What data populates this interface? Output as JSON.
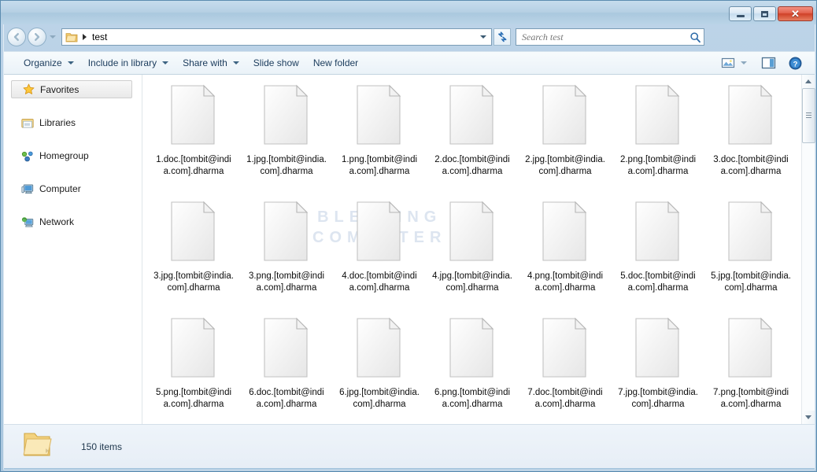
{
  "window": {
    "minimize_label": "Minimize",
    "maximize_label": "Maximize",
    "close_label": "✕"
  },
  "nav": {
    "back_label": "Back",
    "forward_label": "Forward",
    "recent_pages_label": "Recent pages",
    "breadcrumb": "test",
    "refresh_label": "Refresh"
  },
  "search": {
    "placeholder": "Search test",
    "value": ""
  },
  "toolbar": {
    "organize": "Organize",
    "include_in_library": "Include in library",
    "share_with": "Share with",
    "slide_show": "Slide show",
    "new_folder": "New folder",
    "view_label": "Change your view",
    "preview_pane_label": "Show the preview pane",
    "help_label": "Get help"
  },
  "sidebar": {
    "items": [
      {
        "label": "Favorites",
        "icon": "star-icon",
        "selected": true
      },
      {
        "label": "Libraries",
        "icon": "libraries-icon",
        "selected": false
      },
      {
        "label": "Homegroup",
        "icon": "homegroup-icon",
        "selected": false
      },
      {
        "label": "Computer",
        "icon": "computer-icon",
        "selected": false
      },
      {
        "label": "Network",
        "icon": "network-icon",
        "selected": false
      }
    ]
  },
  "watermark": {
    "line1": "BLEEPING",
    "line2": "COMPUTER"
  },
  "files": [
    {
      "name": "1.doc.[tombit@india.com].dharma"
    },
    {
      "name": "1.jpg.[tombit@india.com].dharma"
    },
    {
      "name": "1.png.[tombit@india.com].dharma"
    },
    {
      "name": "2.doc.[tombit@india.com].dharma"
    },
    {
      "name": "2.jpg.[tombit@india.com].dharma"
    },
    {
      "name": "2.png.[tombit@india.com].dharma"
    },
    {
      "name": "3.doc.[tombit@india.com].dharma"
    },
    {
      "name": "3.jpg.[tombit@india.com].dharma"
    },
    {
      "name": "3.png.[tombit@india.com].dharma"
    },
    {
      "name": "4.doc.[tombit@india.com].dharma"
    },
    {
      "name": "4.jpg.[tombit@india.com].dharma"
    },
    {
      "name": "4.png.[tombit@india.com].dharma"
    },
    {
      "name": "5.doc.[tombit@india.com].dharma"
    },
    {
      "name": "5.jpg.[tombit@india.com].dharma"
    },
    {
      "name": "5.png.[tombit@india.com].dharma"
    },
    {
      "name": "6.doc.[tombit@india.com].dharma"
    },
    {
      "name": "6.jpg.[tombit@india.com].dharma"
    },
    {
      "name": "6.png.[tombit@india.com].dharma"
    },
    {
      "name": "7.doc.[tombit@india.com].dharma"
    },
    {
      "name": "7.jpg.[tombit@india.com].dharma"
    },
    {
      "name": "7.png.[tombit@india.com].dharma"
    }
  ],
  "status": {
    "item_count": "150 items"
  },
  "colors": {
    "frame": "#b6d0e4",
    "close_button": "#cf4027",
    "accent_text": "#1a3b5c",
    "watermark": "#dde5f0",
    "folder_yellow": "#f5d888"
  }
}
